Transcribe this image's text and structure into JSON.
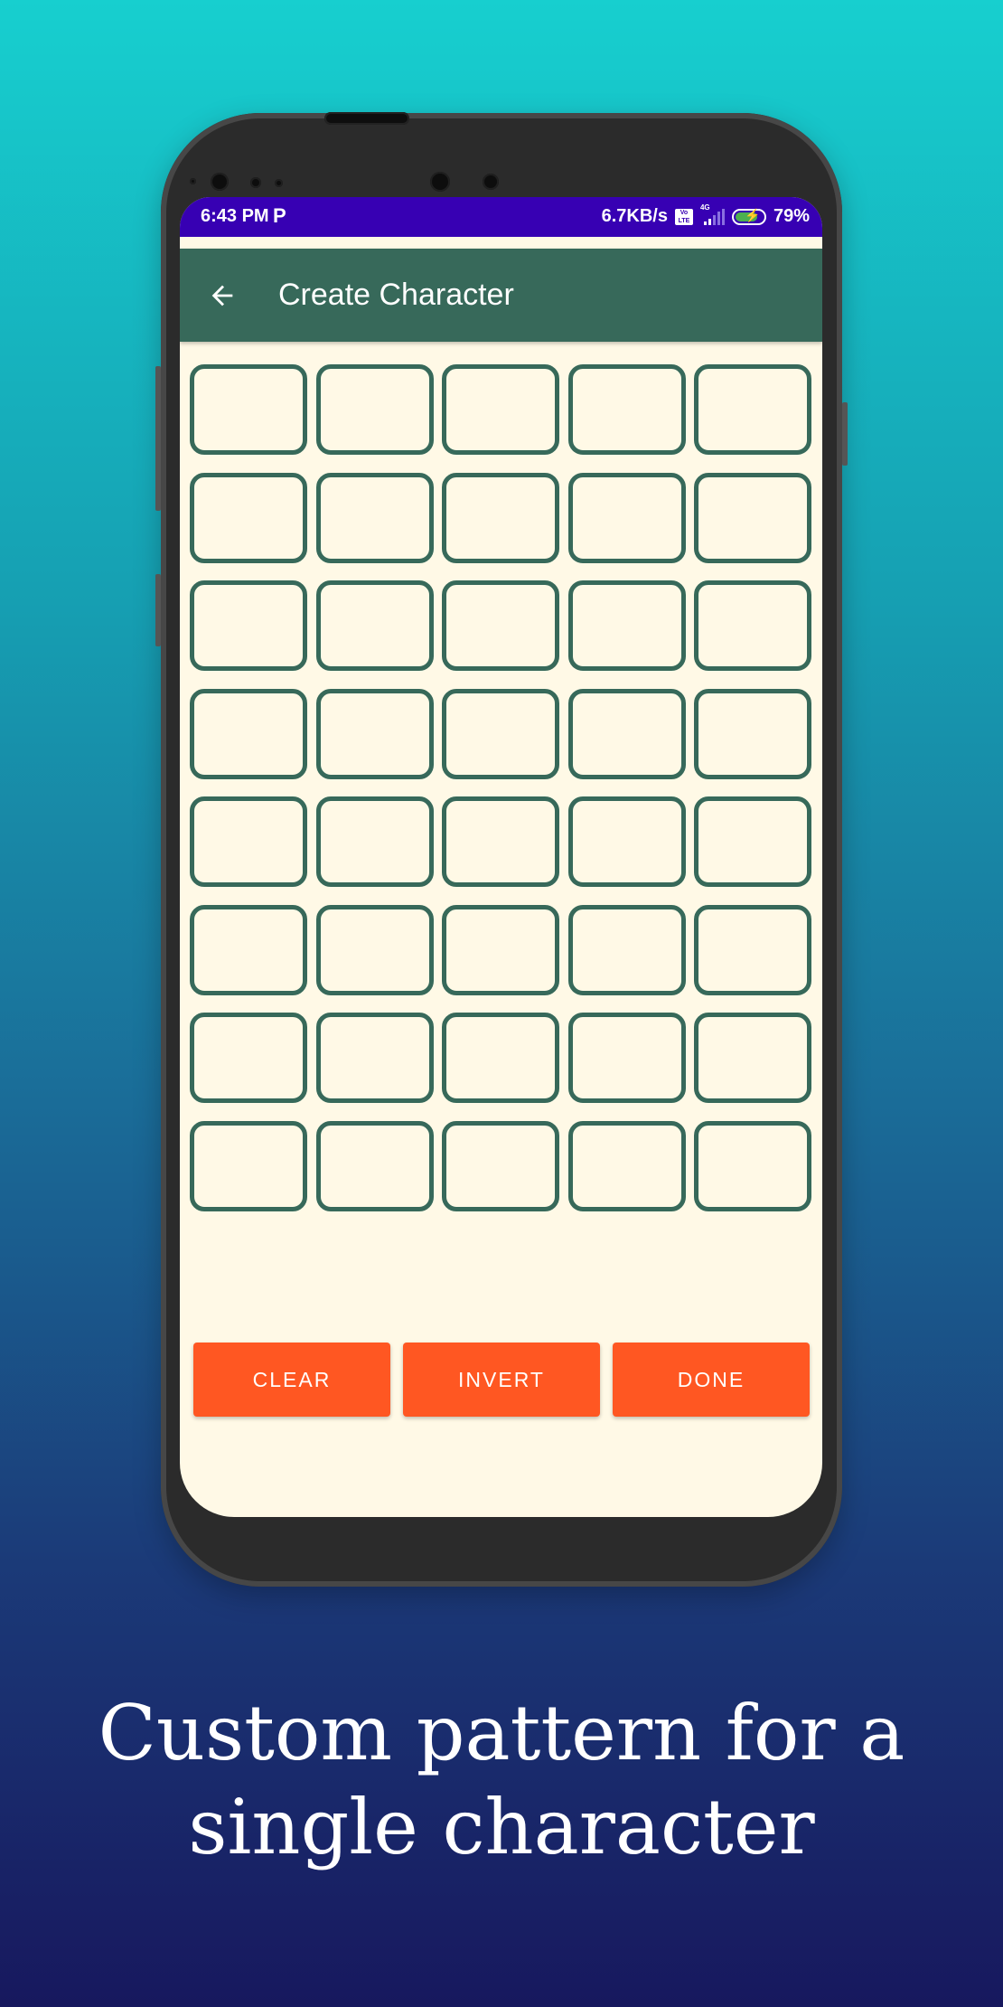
{
  "status_bar": {
    "time": "6:43 PM",
    "notification_icon": "p-icon",
    "network_speed": "6.7KB/s",
    "volte_label": "Vo LTE",
    "network_type": "4G",
    "battery_percent": "79%",
    "battery_level": 0.79,
    "charging": true
  },
  "app_bar": {
    "back_icon": "arrow-left-icon",
    "title": "Create Character"
  },
  "grid": {
    "rows": 8,
    "columns": 5,
    "cells_filled": [
      [
        false,
        false,
        false,
        false,
        false
      ],
      [
        false,
        false,
        false,
        false,
        false
      ],
      [
        false,
        false,
        false,
        false,
        false
      ],
      [
        false,
        false,
        false,
        false,
        false
      ],
      [
        false,
        false,
        false,
        false,
        false
      ],
      [
        false,
        false,
        false,
        false,
        false
      ],
      [
        false,
        false,
        false,
        false,
        false
      ],
      [
        false,
        false,
        false,
        false,
        false
      ]
    ]
  },
  "buttons": {
    "clear": "CLEAR",
    "invert": "INVERT",
    "done": "DONE"
  },
  "nav_bar": {
    "recents_icon": "square-icon",
    "home_icon": "circle-icon",
    "back_icon": "triangle-back-icon"
  },
  "caption": {
    "line1": "Custom pattern for a",
    "line2": "single character"
  },
  "colors": {
    "status_bar": "#3700b3",
    "app_bar": "#37695a",
    "background": "#fff9e6",
    "cell_border": "#37695a",
    "button": "#ff5722"
  }
}
